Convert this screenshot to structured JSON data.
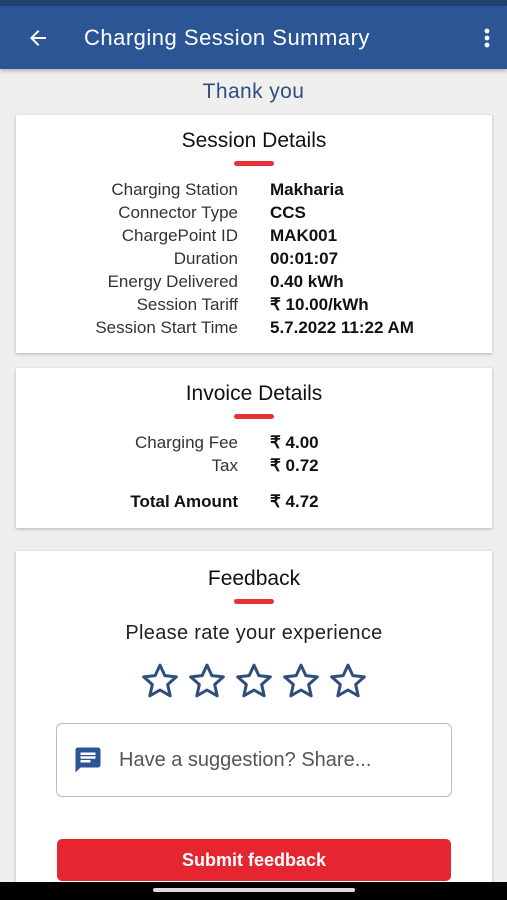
{
  "header": {
    "title": "Charging Session Summary"
  },
  "thanks": "Thank you",
  "session": {
    "heading": "Session Details",
    "rows": [
      {
        "label": "Charging Station",
        "value": "Makharia"
      },
      {
        "label": "Connector Type",
        "value": "CCS"
      },
      {
        "label": "ChargePoint ID",
        "value": "MAK001"
      },
      {
        "label": "Duration",
        "value": "00:01:07"
      },
      {
        "label": "Energy Delivered",
        "value": "0.40 kWh"
      },
      {
        "label": "Session Tariff",
        "value": "₹ 10.00/kWh"
      },
      {
        "label": "Session Start Time",
        "value": "5.7.2022 11:22 AM"
      }
    ]
  },
  "invoice": {
    "heading": "Invoice Details",
    "rows": [
      {
        "label": "Charging Fee",
        "value": "₹ 4.00"
      },
      {
        "label": "Tax",
        "value": "₹ 0.72"
      }
    ],
    "total": {
      "label": "Total Amount",
      "value": "₹ 4.72"
    }
  },
  "feedback": {
    "heading": "Feedback",
    "prompt": "Please rate your experience",
    "rating": 0,
    "max_rating": 5,
    "placeholder": "Have a suggestion? Share...",
    "submit_label": "Submit feedback"
  },
  "colors": {
    "appbar": "#2b5594",
    "accent": "#e53238",
    "submit": "#e5252f",
    "star": "#2f4e7c"
  }
}
